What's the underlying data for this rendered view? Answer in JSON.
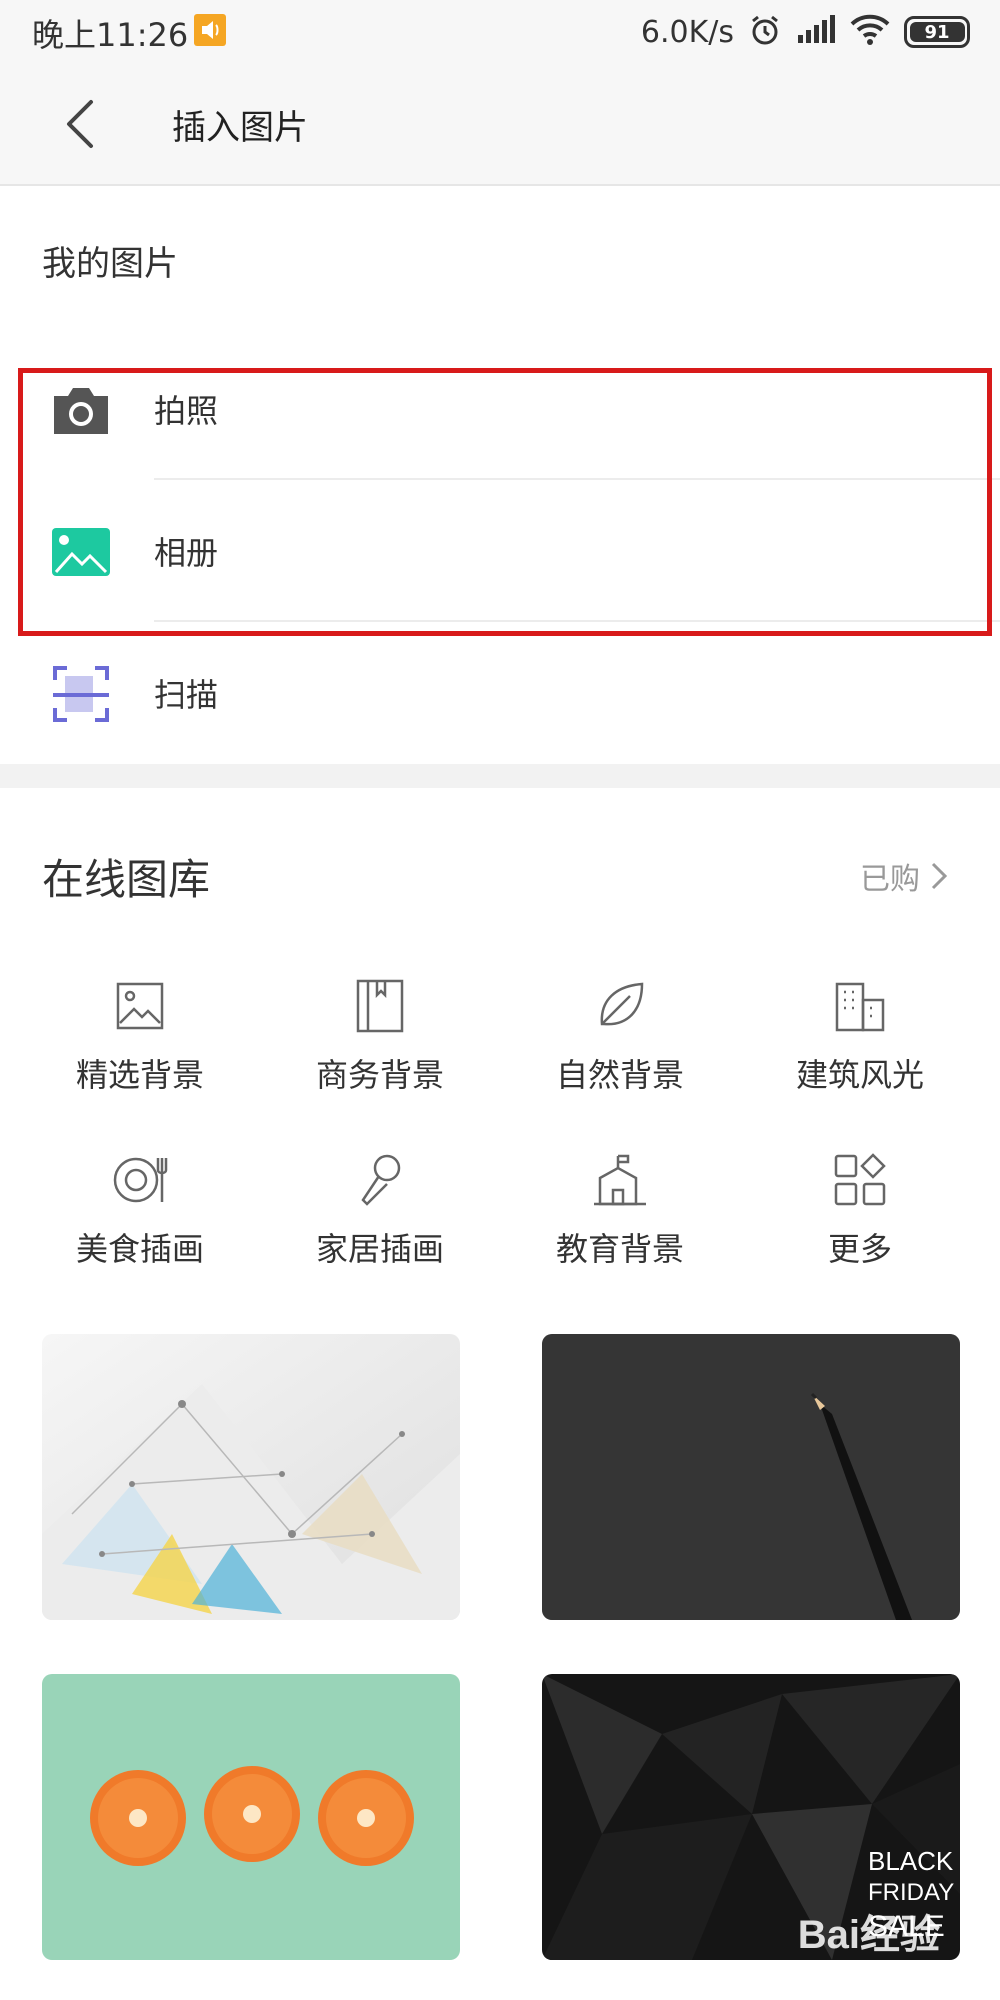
{
  "status_bar": {
    "time": "晚上11:26",
    "network_speed": "6.0K/s",
    "battery": "91",
    "battery_level": 0.91,
    "icons": [
      "volume-icon",
      "alarm-icon",
      "signal-icon",
      "wifi-icon",
      "battery-icon"
    ]
  },
  "header": {
    "title": "插入图片",
    "back_icon": "chevron-left-icon"
  },
  "my_images": {
    "title": "我的图片",
    "items": [
      {
        "label": "拍照",
        "icon": "camera-icon",
        "color": "#555555"
      },
      {
        "label": "相册",
        "icon": "gallery-icon",
        "color": "#1dc9a0"
      },
      {
        "label": "扫描",
        "icon": "scan-icon",
        "color": "#6b6bd6"
      }
    ]
  },
  "online_gallery": {
    "title": "在线图库",
    "purchased_label": "已购",
    "categories": [
      {
        "label": "精选背景",
        "icon": "image-icon"
      },
      {
        "label": "商务背景",
        "icon": "book-icon"
      },
      {
        "label": "自然背景",
        "icon": "leaf-icon"
      },
      {
        "label": "建筑风光",
        "icon": "building-icon"
      },
      {
        "label": "美食插画",
        "icon": "plate-icon"
      },
      {
        "label": "家居插画",
        "icon": "microphone-icon"
      },
      {
        "label": "教育背景",
        "icon": "school-icon"
      },
      {
        "label": "更多",
        "icon": "more-apps-icon"
      }
    ],
    "thumbnails": [
      {
        "name": "geometric-light-background"
      },
      {
        "name": "pencil-dark-background"
      },
      {
        "name": "oranges-green-background"
      },
      {
        "name": "black-friday-sale-background"
      }
    ],
    "watermark": "Bai经验"
  },
  "colors": {
    "highlight": "#d81a1a",
    "gallery_icon": "#1dc9a0",
    "scan_icon": "#6b6bd6"
  }
}
